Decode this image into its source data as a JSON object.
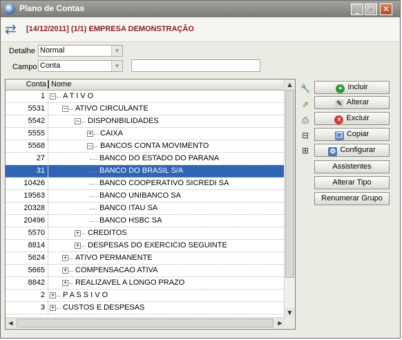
{
  "window": {
    "title": "Plano de Contas"
  },
  "header": {
    "text": "[14/12/2011] (1/1) EMPRESA DEMONSTRAÇÃO"
  },
  "filters": {
    "detalhe_label": "Detalhe",
    "detalhe_value": "Normal",
    "campo_label": "Campo",
    "campo_value": "Conta",
    "search_value": ""
  },
  "grid": {
    "columns": [
      "Conta",
      "Nome"
    ],
    "rows": [
      {
        "code": "1",
        "name": "A T I V O",
        "level": 0,
        "toggle": "minus"
      },
      {
        "code": "5531",
        "name": "ATIVO CIRCULANTE",
        "level": 1,
        "toggle": "minus"
      },
      {
        "code": "5542",
        "name": "DISPONIBILIDADES",
        "level": 2,
        "toggle": "minus"
      },
      {
        "code": "5555",
        "name": "CAIXA",
        "level": 3,
        "toggle": "plus"
      },
      {
        "code": "5568",
        "name": "BANCOS CONTA MOVIMENTO",
        "level": 3,
        "toggle": "minus"
      },
      {
        "code": "27",
        "name": "BANCO DO ESTADO DO PARANA",
        "level": 4,
        "toggle": ""
      },
      {
        "code": "31",
        "name": "BANCO DO BRASIL S/A",
        "level": 4,
        "toggle": "",
        "selected": true
      },
      {
        "code": "10426",
        "name": "BANCO COOPERATIVO SICREDI SA",
        "level": 4,
        "toggle": ""
      },
      {
        "code": "19563",
        "name": "BANCO UNIBANCO SA",
        "level": 4,
        "toggle": ""
      },
      {
        "code": "20328",
        "name": "BANCO ITAU SA",
        "level": 4,
        "toggle": ""
      },
      {
        "code": "20496",
        "name": "BANCO HSBC SA",
        "level": 4,
        "toggle": ""
      },
      {
        "code": "5570",
        "name": "CREDITOS",
        "level": 2,
        "toggle": "plus"
      },
      {
        "code": "8814",
        "name": "DESPESAS DO EXERCICIO SEGUINTE",
        "level": 2,
        "toggle": "plus"
      },
      {
        "code": "5624",
        "name": "ATIVO PERMANENTE",
        "level": 1,
        "toggle": "plus"
      },
      {
        "code": "5665",
        "name": "COMPENSACAO ATIVA",
        "level": 1,
        "toggle": "plus"
      },
      {
        "code": "8842",
        "name": "REALIZAVEL A LONGO PRAZO",
        "level": 1,
        "toggle": "plus"
      },
      {
        "code": "2",
        "name": "P A S S I V O",
        "level": 0,
        "toggle": "plus"
      },
      {
        "code": "3",
        "name": "CUSTOS E DESPESAS",
        "level": 0,
        "toggle": "plus"
      }
    ]
  },
  "buttons": {
    "incluir": "Incluir",
    "alterar": "Alterar",
    "excluir": "Excluir",
    "copiar": "Copiar",
    "configurar": "Configurar",
    "assistentes": "Assistentes",
    "alterar_tipo": "Alterar Tipo",
    "renumerar_grupo": "Renumerar Grupo"
  },
  "side_icons": [
    "wrench-icon",
    "export-icon",
    "print-icon",
    "collapse-tree-icon",
    "expand-tree-icon"
  ],
  "colors": {
    "header_text": "#8a1b1b",
    "selection": "#2f64b6",
    "titlebar": "#8f8f8b"
  }
}
